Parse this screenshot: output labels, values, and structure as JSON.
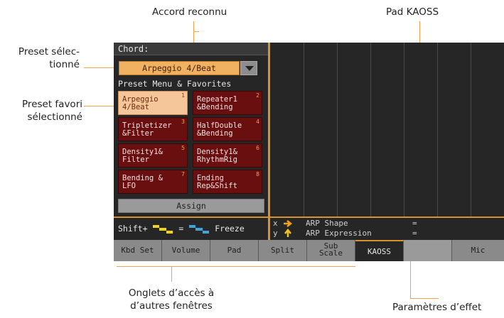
{
  "callouts": {
    "accord_reconnu": "Accord reconnu",
    "pad_kaoss": "Pad KAOSS",
    "preset_selectionne_1": "Preset sélec-",
    "preset_selectionne_2": "tionné",
    "preset_favori_1": "Preset favori",
    "preset_favori_2": "sélectionné",
    "onglets_1": "Onglets d’accès à",
    "onglets_2": "d’autres fenêtres",
    "parametres": "Paramètres d’effet"
  },
  "screen": {
    "chord_label": "Chord:",
    "preset_value": "Arpeggio 4/Beat",
    "menu_title": "Preset Menu & Favorites",
    "favorites": [
      {
        "num": "1",
        "line1": "Arpeggio",
        "line2": "4/Beat"
      },
      {
        "num": "2",
        "line1": "Repeater1",
        "line2": "&Bending"
      },
      {
        "num": "3",
        "line1": "Tripletizer",
        "line2": "&Filter"
      },
      {
        "num": "4",
        "line1": "HalfDouble",
        "line2": "&Bending"
      },
      {
        "num": "5",
        "line1": "Density1&",
        "line2": "Filter"
      },
      {
        "num": "6",
        "line1": "Density1&",
        "line2": "RhythmRig"
      },
      {
        "num": "7",
        "line1": "Bending &",
        "line2": "LFO"
      },
      {
        "num": "8",
        "line1": "Ending",
        "line2": "Rep&Shift"
      }
    ],
    "assign_label": "Assign",
    "shift_label": "Shift+",
    "equals": "=",
    "freeze_label": "Freeze",
    "x_label": "x",
    "y_label": "y",
    "x_param": "ARP Shape",
    "y_param": "ARP Expression",
    "x_value": "=",
    "y_value": "=",
    "tabs": [
      {
        "line1": "Kbd Set",
        "line2": ""
      },
      {
        "line1": "Volume",
        "line2": ""
      },
      {
        "line1": "Pad",
        "line2": ""
      },
      {
        "line1": "Split",
        "line2": ""
      },
      {
        "line1": "Sub",
        "line2": "Scale"
      },
      {
        "line1": "KAOSS",
        "line2": ""
      },
      {
        "line1": "",
        "line2": ""
      },
      {
        "line1": "Mic",
        "line2": ""
      }
    ]
  },
  "colors": {
    "accent": "#d8922f",
    "callout_line": "#f0a24c",
    "favorite_bg": "#6a0f0f",
    "favorite_selected_bg": "#f6c69b",
    "arrow_x": "#f4a21e",
    "arrow_y": "#f4c21e",
    "pad_yellow": "#f2d21b",
    "pad_blue": "#3ba6dc"
  }
}
